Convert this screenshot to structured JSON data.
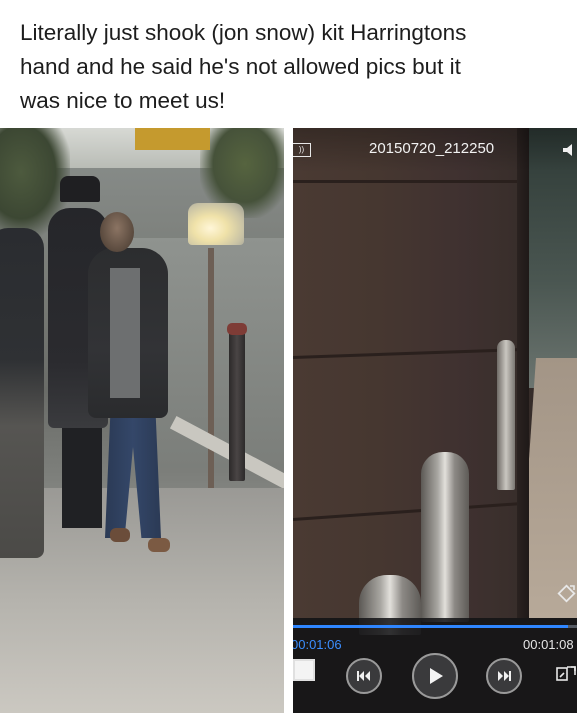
{
  "caption": {
    "line1": "Literally just shook (jon snow) kit Harringtons",
    "line2": "hand and he said he's not allowed pics but it",
    "line3": "was nice to meet us!"
  },
  "player": {
    "filename": "20150720_212250",
    "current_time": "00:01:06",
    "total_time": "00:01:08",
    "progress_fraction": 0.97,
    "accent_color": "#2f86ff",
    "icons": {
      "back": "back-icon",
      "volume": "volume-icon",
      "rotate": "rotate-icon",
      "stop": "stop-icon",
      "previous": "previous-icon",
      "play": "play-icon",
      "next": "next-icon",
      "fit": "fit-screen-icon"
    }
  }
}
